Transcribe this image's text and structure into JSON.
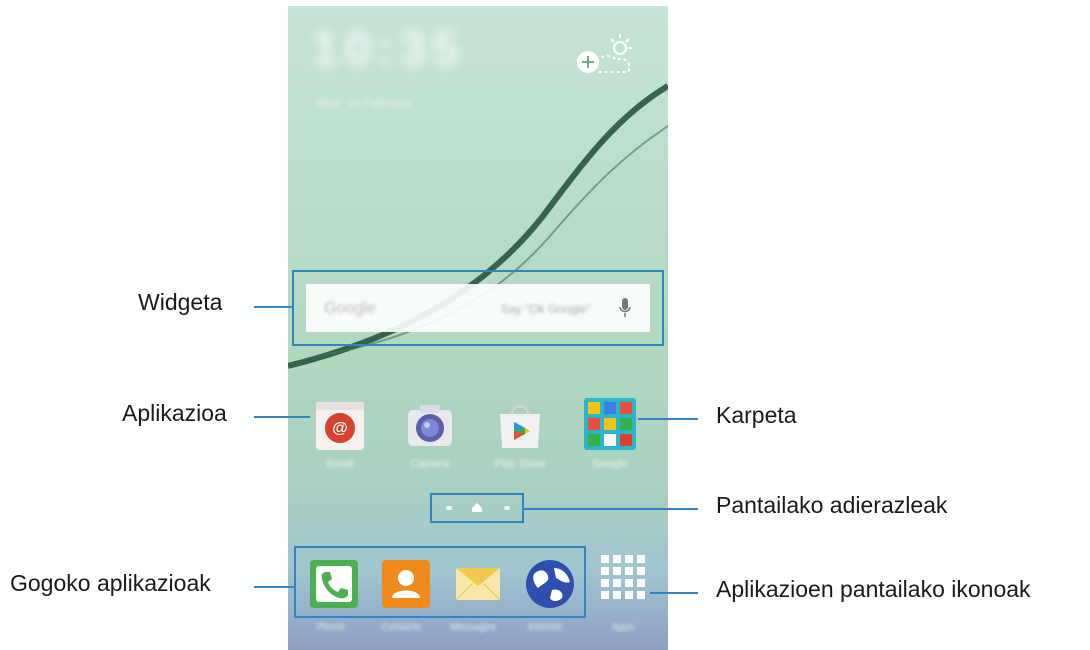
{
  "callouts": {
    "widget": "Widgeta",
    "app": "Aplikazioa",
    "favorites": "Gogoko aplikazioak",
    "folder": "Karpeta",
    "indicators": "Pantailako adierazleak",
    "apps_screen_icon": "Aplikazioen pantailako ikonoak"
  },
  "phone": {
    "clock": "10:35",
    "date": "Wed, 14 February",
    "search_brand": "Google",
    "search_hint": "Say \"Ok Google\"",
    "apps": [
      {
        "label": "Email",
        "icon": "email-icon"
      },
      {
        "label": "Camera",
        "icon": "camera-icon"
      },
      {
        "label": "Play Store",
        "icon": "play-store-icon"
      },
      {
        "label": "Google",
        "icon": "google-folder-icon"
      }
    ],
    "dock": [
      {
        "label": "Phone",
        "icon": "phone-icon"
      },
      {
        "label": "Contacts",
        "icon": "contacts-icon"
      },
      {
        "label": "Messages",
        "icon": "messages-icon"
      },
      {
        "label": "Internet",
        "icon": "internet-icon"
      }
    ],
    "apps_button_label": "Apps"
  },
  "colors": {
    "annotation_blue": "#2f86c0"
  }
}
